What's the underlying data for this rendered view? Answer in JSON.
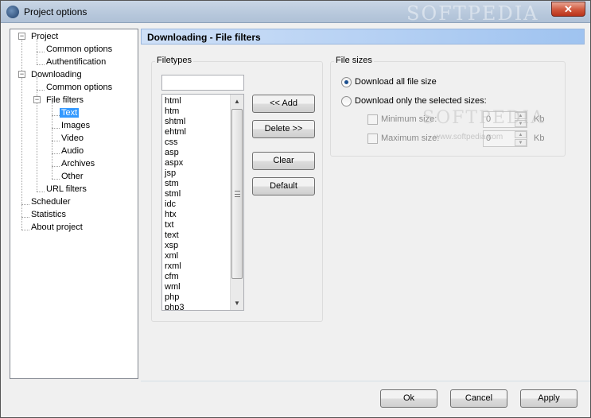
{
  "window": {
    "title": "Project options",
    "watermark": "SOFTPEDIA",
    "close_label": "✕"
  },
  "tree": {
    "items": [
      {
        "label": "Project",
        "expander": "−"
      },
      {
        "label": "Common options"
      },
      {
        "label": "Authentification"
      },
      {
        "label": "Downloading",
        "expander": "−"
      },
      {
        "label": "Common options"
      },
      {
        "label": "File filters",
        "expander": "−"
      },
      {
        "label": "Text",
        "selected": true
      },
      {
        "label": "Images"
      },
      {
        "label": "Video"
      },
      {
        "label": "Audio"
      },
      {
        "label": "Archives"
      },
      {
        "label": "Other"
      },
      {
        "label": "URL filters"
      },
      {
        "label": "Scheduler"
      },
      {
        "label": "Statistics"
      },
      {
        "label": "About project"
      }
    ]
  },
  "header": {
    "title": "Downloading - File filters"
  },
  "filetypes": {
    "group_label": "Filetypes",
    "filter_value": "",
    "items": [
      "html",
      "htm",
      "shtml",
      "ehtml",
      "css",
      "asp",
      "aspx",
      "jsp",
      "stm",
      "stml",
      "idc",
      "htx",
      "txt",
      "text",
      "xsp",
      "xml",
      "rxml",
      "cfm",
      "wml",
      "php",
      "php3"
    ],
    "buttons": {
      "add": "<< Add",
      "delete": "Delete >>",
      "clear": "Clear",
      "default": "Default"
    }
  },
  "file_sizes": {
    "group_label": "File sizes",
    "option_all": "Download all file size",
    "option_selected": "Download only the selected sizes:",
    "selected_option": "all",
    "min_label": "Minimum size:",
    "min_value": "0",
    "max_label": "Maximum size:",
    "max_value": "0",
    "unit": "Kb",
    "watermark": "SOFTPEDIA",
    "watermark_small": "www.softpedia.com"
  },
  "footer": {
    "ok": "Ok",
    "cancel": "Cancel",
    "apply": "Apply"
  }
}
